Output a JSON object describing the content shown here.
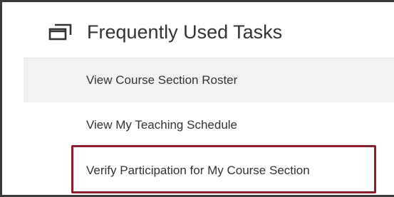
{
  "panel": {
    "title": "Frequently Used Tasks",
    "title_icon": "window-stack-icon",
    "items": [
      {
        "label": "View Course Section Roster",
        "highlighted": true
      },
      {
        "label": "View My Teaching Schedule",
        "highlighted": false
      },
      {
        "label": "Verify Participation for My Course Section",
        "highlighted": false,
        "callout": true
      }
    ]
  },
  "colors": {
    "frame": "#3a3a3a",
    "text": "#333333",
    "highlight": "#f2f2f2",
    "callout": "#8b1f2f"
  }
}
